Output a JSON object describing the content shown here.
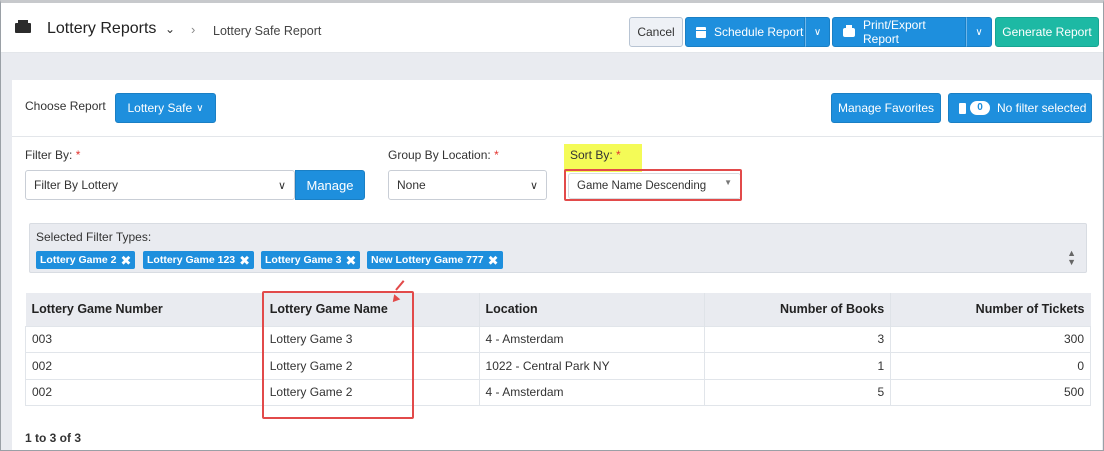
{
  "header": {
    "app_title": "Lottery Reports",
    "breadcrumb": "Lottery Safe Report",
    "cancel_label": "Cancel",
    "schedule_label": "Schedule Report",
    "print_label": "Print/Export Report",
    "generate_label": "Generate Report"
  },
  "report_bar": {
    "choose_label": "Choose Report",
    "choose_value": "Lottery Safe",
    "manage_favorites_label": "Manage Favorites",
    "filter_count": "0",
    "no_filter_label": "No filter selected"
  },
  "filters": {
    "filter_by_label": "Filter By:",
    "filter_by_value": "Filter By Lottery",
    "manage_label": "Manage",
    "group_by_label": "Group By Location:",
    "group_by_value": "None",
    "sort_by_label": "Sort By:",
    "sort_by_value": "Game Name Descending",
    "required_mark": "*"
  },
  "selected_filters": {
    "title": "Selected Filter Types:",
    "chips": [
      "Lottery Game 2",
      "Lottery Game 123",
      "Lottery Game 3",
      "New Lottery Game 777"
    ]
  },
  "table": {
    "columns": [
      "Lottery Game Number",
      "Lottery Game Name",
      "Location",
      "Number of Books",
      "Number of Tickets"
    ],
    "rows": [
      [
        "003",
        "Lottery Game 3",
        "4 - Amsterdam",
        "3",
        "300"
      ],
      [
        "002",
        "Lottery Game 2",
        "1022 - Central Park NY",
        "1",
        "0"
      ],
      [
        "002",
        "Lottery Game 2",
        "4 - Amsterdam",
        "5",
        "500"
      ]
    ]
  },
  "paging": {
    "summary": "1 to 3 of 3"
  },
  "colors": {
    "primary": "#1e8fdd",
    "generate": "#1db9a4",
    "highlight": "#f4fb57",
    "annotation": "#e24a4a"
  }
}
